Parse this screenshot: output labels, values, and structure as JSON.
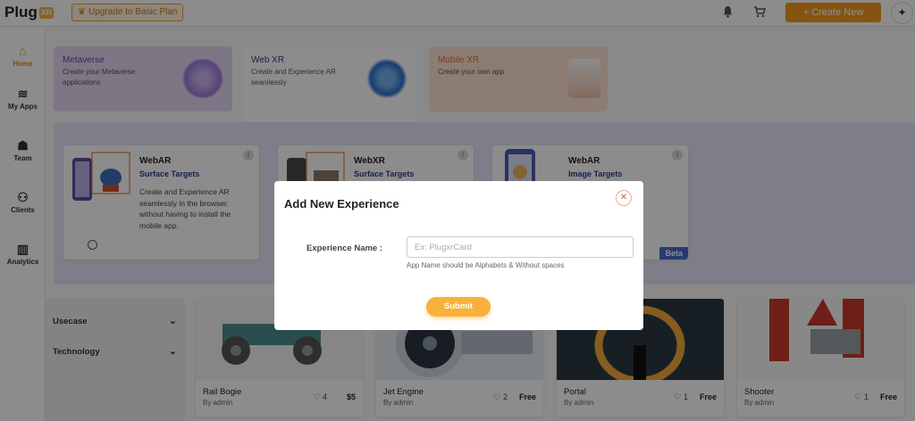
{
  "header": {
    "logo_text": "Plug",
    "logo_badge": "XR",
    "upgrade_label": "Upgrade to Basic Plan",
    "create_label": "+ Create New"
  },
  "sidebar": {
    "items": [
      {
        "label": "Home",
        "icon": "home-icon",
        "active": true
      },
      {
        "label": "My Apps",
        "icon": "layers-icon"
      },
      {
        "label": "Team",
        "icon": "team-icon"
      },
      {
        "label": "Clients",
        "icon": "clients-icon"
      },
      {
        "label": "Analytics",
        "icon": "analytics-icon"
      }
    ]
  },
  "categories": [
    {
      "title": "Metaverse",
      "subtitle": "Create your Metaverse applications"
    },
    {
      "title": "Web XR",
      "subtitle": "Create and Experience AR seamlessly"
    },
    {
      "title": "Mobile XR",
      "subtitle": "Create your own app"
    }
  ],
  "cards": [
    {
      "type": "WebAR",
      "subtitle": "Surface Targets",
      "description": "Create and Experience AR seamlessly in the browser. without having to install the mobile app."
    },
    {
      "type": "WebXR",
      "subtitle": "Surface Targets",
      "description": ""
    },
    {
      "type": "WebAR",
      "subtitle": "Image Targets",
      "description": "",
      "badge": "Beta"
    }
  ],
  "filters": [
    {
      "label": "Usecase"
    },
    {
      "label": "Technology"
    }
  ],
  "products": [
    {
      "name": "Rail Bogie",
      "by": "By admin",
      "likes": "4",
      "price": "$5"
    },
    {
      "name": "Jet Engine",
      "by": "By admin",
      "likes": "2",
      "price": "Free"
    },
    {
      "name": "Portal",
      "by": "By admin",
      "likes": "1",
      "price": "Free"
    },
    {
      "name": "Shooter",
      "by": "By admin",
      "likes": "1",
      "price": "Free"
    }
  ],
  "modal": {
    "title": "Add New Experience",
    "field_label": "Experience Name :",
    "field_placeholder": "Ex: PlugxrCard",
    "field_value": "",
    "hint": "App Name should be Alphabets & Without spaces",
    "submit_label": "Submit",
    "close_icon": "close-icon"
  },
  "colors": {
    "accent": "#f59a1e",
    "submit": "#f7b23b",
    "link": "#2b3a8c",
    "beta": "#4a6cc9"
  }
}
